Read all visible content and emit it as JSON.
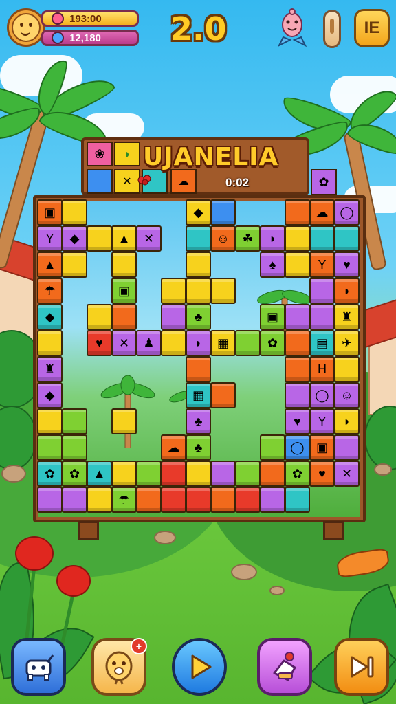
{
  "hud": {
    "coins": "193:00",
    "gems": "12,180",
    "level": "2.0",
    "menu_label": "IE"
  },
  "sign": {
    "title": "UJANELIA",
    "timer": "0:02"
  },
  "board": {
    "tiles": [
      {
        "c": "o",
        "g": "▣"
      },
      {
        "c": "y",
        "g": ""
      },
      {
        "c": "y",
        "g": "◆"
      },
      {
        "c": "b",
        "g": ""
      },
      {
        "c": "o",
        "g": ""
      },
      {
        "c": "o",
        "g": "☁"
      },
      {
        "c": "p",
        "g": "◯"
      },
      {
        "c": "p",
        "g": "Y"
      },
      {
        "c": "p",
        "g": "◆"
      },
      {
        "c": "y",
        "g": ""
      },
      {
        "c": "y",
        "g": "▲"
      },
      {
        "c": "p",
        "g": "✕"
      },
      {
        "c": "t",
        "g": ""
      },
      {
        "c": "o",
        "g": "☺"
      },
      {
        "c": "g",
        "g": "☘"
      },
      {
        "c": "p",
        "g": "◗"
      },
      {
        "c": "y",
        "g": ""
      },
      {
        "c": "t",
        "g": ""
      },
      {
        "c": "t",
        "g": ""
      },
      {
        "c": "o",
        "g": "▲"
      },
      {
        "c": "y",
        "g": ""
      },
      {
        "c": "y",
        "g": ""
      },
      {
        "c": "y",
        "g": ""
      },
      {
        "c": "p",
        "g": "♠"
      },
      {
        "c": "y",
        "g": ""
      },
      {
        "c": "o",
        "g": "Y"
      },
      {
        "c": "p",
        "g": "♥"
      },
      {
        "c": "o",
        "g": "☂"
      },
      {
        "c": "g",
        "g": "▣"
      },
      {
        "c": "y",
        "g": ""
      },
      {
        "c": "y",
        "g": ""
      },
      {
        "c": "y",
        "g": ""
      },
      {
        "c": "p",
        "g": ""
      },
      {
        "c": "o",
        "g": "◗"
      },
      {
        "c": "t",
        "g": "◆"
      },
      {
        "c": "y",
        "g": ""
      },
      {
        "c": "o",
        "g": ""
      },
      {
        "c": "p",
        "g": ""
      },
      {
        "c": "g",
        "g": "♣"
      },
      {
        "c": "g",
        "g": "▣"
      },
      {
        "c": "p",
        "g": ""
      },
      {
        "c": "p",
        "g": ""
      },
      {
        "c": "y",
        "g": "♜"
      },
      {
        "c": "y",
        "g": ""
      },
      {
        "c": "r",
        "g": "♥"
      },
      {
        "c": "p",
        "g": "✕"
      },
      {
        "c": "p",
        "g": "♟"
      },
      {
        "c": "y",
        "g": ""
      },
      {
        "c": "p",
        "g": "◗"
      },
      {
        "c": "y",
        "g": "▦"
      },
      {
        "c": "g",
        "g": ""
      },
      {
        "c": "g",
        "g": "✿"
      },
      {
        "c": "o",
        "g": ""
      },
      {
        "c": "t",
        "g": "▤"
      },
      {
        "c": "y",
        "g": "✈"
      },
      {
        "c": "p",
        "g": "♜"
      },
      {
        "c": "o",
        "g": ""
      },
      {
        "c": "o",
        "g": ""
      },
      {
        "c": "o",
        "g": "H"
      },
      {
        "c": "y",
        "g": ""
      },
      {
        "c": "p",
        "g": "◆"
      },
      {
        "c": "t",
        "g": "▦"
      },
      {
        "c": "o",
        "g": ""
      },
      {
        "c": "p",
        "g": ""
      },
      {
        "c": "p",
        "g": "◯"
      },
      {
        "c": "p",
        "g": "☺"
      },
      {
        "c": "y",
        "g": ""
      },
      {
        "c": "g",
        "g": ""
      },
      {
        "c": "y",
        "g": ""
      },
      {
        "c": "p",
        "g": "♣"
      },
      {
        "c": "p",
        "g": "♥"
      },
      {
        "c": "p",
        "g": "Y"
      },
      {
        "c": "y",
        "g": "◗"
      },
      {
        "c": "g",
        "g": ""
      },
      {
        "c": "g",
        "g": ""
      },
      {
        "c": "o",
        "g": "☁"
      },
      {
        "c": "g",
        "g": "♣"
      },
      {
        "c": "g",
        "g": ""
      },
      {
        "c": "b",
        "g": "◯"
      },
      {
        "c": "o",
        "g": "▣"
      },
      {
        "c": "p",
        "g": ""
      },
      {
        "c": "t",
        "g": "✿"
      },
      {
        "c": "g",
        "g": "✿"
      },
      {
        "c": "t",
        "g": "▲"
      },
      {
        "c": "y",
        "g": ""
      },
      {
        "c": "g",
        "g": ""
      },
      {
        "c": "r",
        "g": ""
      },
      {
        "c": "y",
        "g": ""
      },
      {
        "c": "p",
        "g": ""
      },
      {
        "c": "g",
        "g": ""
      },
      {
        "c": "o",
        "g": ""
      },
      {
        "c": "g",
        "g": "✿"
      },
      {
        "c": "o",
        "g": "♥"
      },
      {
        "c": "p",
        "g": "✕"
      },
      {
        "c": "p",
        "g": ""
      },
      {
        "c": "p",
        "g": ""
      },
      {
        "c": "y",
        "g": ""
      },
      {
        "c": "g",
        "g": "☂"
      },
      {
        "c": "o",
        "g": ""
      },
      {
        "c": "r",
        "g": ""
      },
      {
        "c": "r",
        "g": ""
      },
      {
        "c": "o",
        "g": ""
      },
      {
        "c": "r",
        "g": ""
      },
      {
        "c": "p",
        "g": ""
      },
      {
        "c": "t",
        "g": ""
      }
    ]
  },
  "colors": {
    "y": "#f7d21d",
    "p": "#b866e6",
    "o": "#f26a1c",
    "r": "#e83a2a",
    "g": "#7fd032",
    "t": "#2fc5c5",
    "b": "#3d8ff0",
    "k": "#ef5fa0"
  },
  "controls": {
    "badge": "+",
    "icons": [
      "cow-icon",
      "friend-face-icon",
      "play-icon",
      "gift-icon",
      "next-icon"
    ]
  }
}
